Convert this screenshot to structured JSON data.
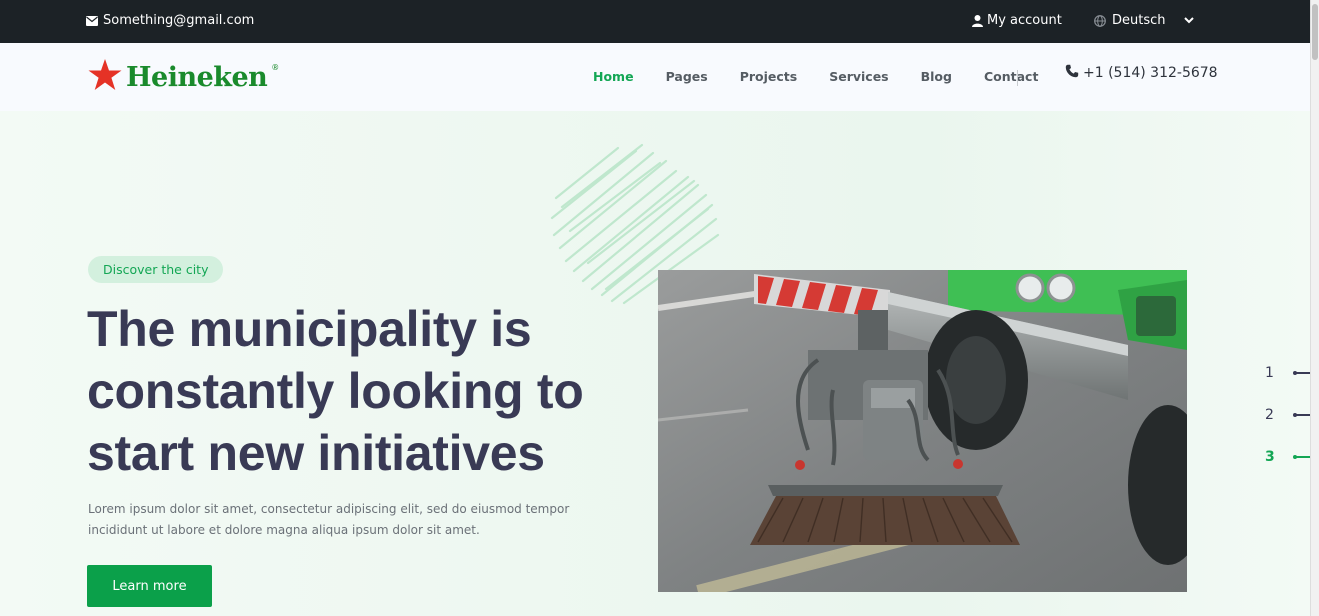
{
  "topbar": {
    "email": "Something@gmail.com",
    "account": "My account",
    "language": "Deutsch"
  },
  "header": {
    "brand": "Heineken",
    "brand_mark": "®",
    "nav": [
      "Home",
      "Pages",
      "Projects",
      "Services",
      "Blog",
      "Contact"
    ],
    "active_nav": "Home",
    "phone": "+1 (514) 312-5678"
  },
  "hero": {
    "tag": "Discover the city",
    "headline_lines": [
      "The municipality is",
      "constantly looking to",
      "start new initiatives"
    ],
    "description": "Lorem ipsum dolor sit amet, consectetur adipiscing elit, sed do eiusmod tempor incididunt ut labore et dolore magna aliqua ipsum dolor sit amet.",
    "button": "Learn more"
  },
  "slider": {
    "items": [
      "1",
      "2",
      "3"
    ],
    "active": "3"
  },
  "colors": {
    "accent": "#13a654",
    "topbar": "#1c2226",
    "heading": "#393a55",
    "logo_star": "#e53226",
    "logo_text": "#1a8a2c"
  },
  "icons": {
    "email": "envelope-icon",
    "account": "user-icon",
    "language": "globe-icon",
    "dropdown": "chevron-down-icon",
    "phone": "phone-icon",
    "logo": "star-icon"
  }
}
